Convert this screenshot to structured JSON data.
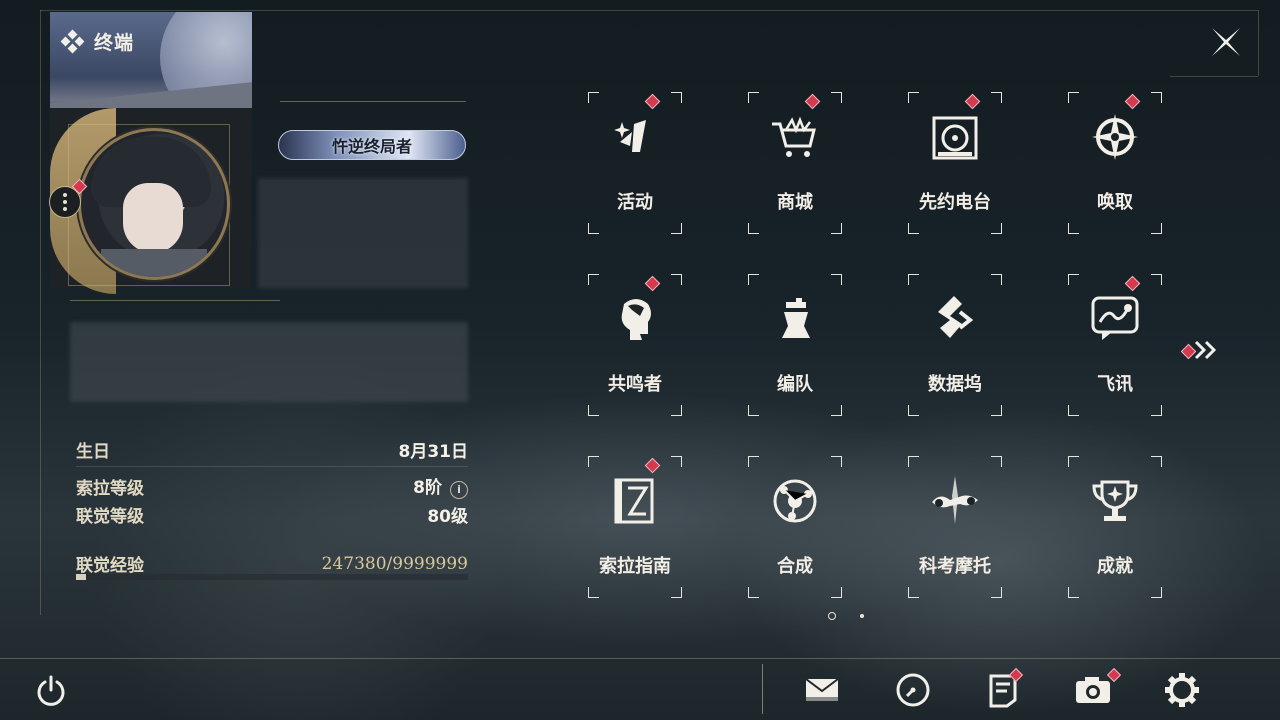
{
  "header": {
    "title": "终端",
    "close_icon": "close-x-icon"
  },
  "profile": {
    "badge_name": "忤逆终局者",
    "more_icon": "more-vertical-icon"
  },
  "stats": {
    "birthday_label": "生日",
    "birthday_value": "8月31日",
    "sola_level_label": "索拉等级",
    "sola_level_value": "8阶",
    "union_level_label": "联觉等级",
    "union_level_value": "80级",
    "union_exp_label": "联觉经验",
    "union_exp_value": "247380/9999999",
    "union_exp_fraction": 0.025
  },
  "menu": [
    {
      "label": "活动",
      "icon": "sparkle-icon",
      "notify": true
    },
    {
      "label": "商城",
      "icon": "shop-cart-icon",
      "notify": true
    },
    {
      "label": "先约电台",
      "icon": "radio-icon",
      "notify": true
    },
    {
      "label": "唤取",
      "icon": "compass-star-icon",
      "notify": true
    },
    {
      "label": "共鸣者",
      "icon": "resonator-head-icon",
      "notify": true
    },
    {
      "label": "编队",
      "icon": "chess-team-icon",
      "notify": false
    },
    {
      "label": "数据坞",
      "icon": "data-dock-icon",
      "notify": false
    },
    {
      "label": "飞讯",
      "icon": "message-icon",
      "notify": true
    },
    {
      "label": "索拉指南",
      "icon": "guide-book-icon",
      "notify": true
    },
    {
      "label": "合成",
      "icon": "synthesis-icon",
      "notify": false
    },
    {
      "label": "科考摩托",
      "icon": "motorbike-icon",
      "notify": false
    },
    {
      "label": "成就",
      "icon": "trophy-icon",
      "notify": false
    }
  ],
  "pager": {
    "current": 1,
    "total": 2
  },
  "bottom_bar": [
    {
      "name": "mail-icon",
      "notify": false
    },
    {
      "name": "clock-icon",
      "notify": false
    },
    {
      "name": "notice-icon",
      "notify": true
    },
    {
      "name": "camera-icon",
      "notify": true
    },
    {
      "name": "settings-gear-icon",
      "notify": false
    }
  ],
  "colors": {
    "accent_gold": "#c8b48c",
    "notify_red": "#d33a4e",
    "text": "#f2eee5"
  }
}
